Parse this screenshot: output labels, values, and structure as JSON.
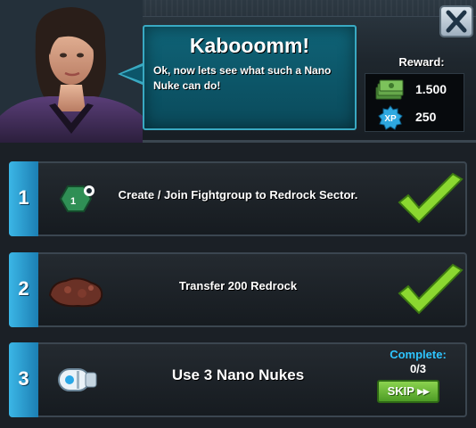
{
  "dialog": {
    "title": "Kabooomm!",
    "message": "Ok, now lets see what such a Nano Nuke can do!",
    "close_label": "X",
    "close_icon": "close-icon"
  },
  "reward": {
    "label": "Reward:",
    "items": [
      {
        "icon": "cash-icon",
        "value": "1.500"
      },
      {
        "icon": "xp-badge-icon",
        "icon_text": "XP",
        "value": "250"
      }
    ]
  },
  "quests": [
    {
      "index": "1",
      "text": "Create / Join Fightgroup to Redrock Sector.",
      "icon": "fightgroup-hex-icon",
      "icon_text": "1",
      "completed": true
    },
    {
      "index": "2",
      "text": "Transfer 200 Redrock",
      "icon": "redrock-ore-icon",
      "completed": true
    },
    {
      "index": "3",
      "text": "Use 3 Nano Nukes",
      "icon": "nano-nuke-icon",
      "completed": false,
      "complete_label": "Complete:",
      "progress": "0/3",
      "skip_label": "SKIP ▸▸"
    }
  ],
  "colors": {
    "accent": "#2ec5ff",
    "check": "#8bd830",
    "speech": "#0f6377"
  }
}
